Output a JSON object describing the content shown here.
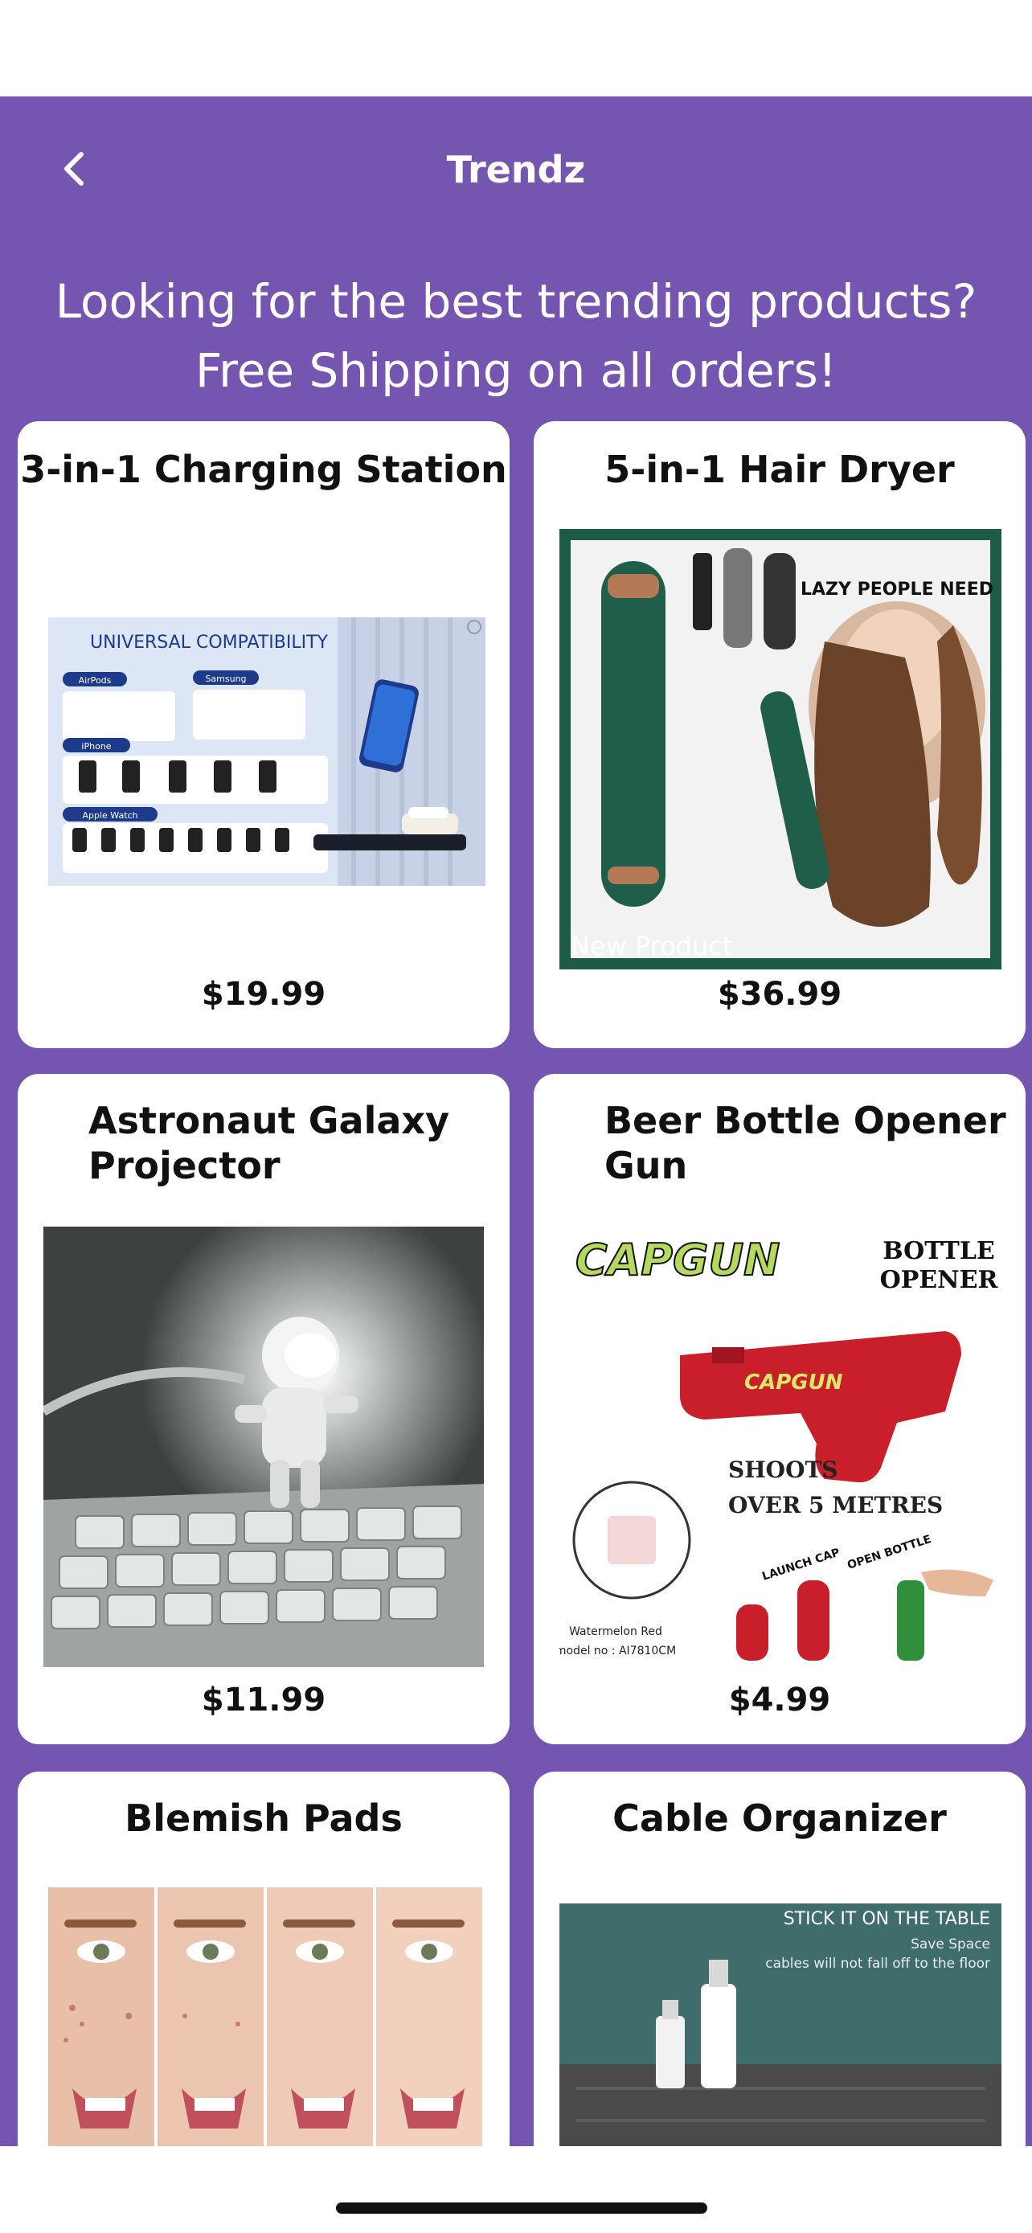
{
  "header": {
    "title": "Trendz",
    "banner_line1": "Looking for the best trending products?",
    "banner_line2": "Free Shipping on all orders!"
  },
  "colors": {
    "background_purple": "#7455b0",
    "card_background": "#ffffff"
  },
  "products": [
    {
      "name": "3-in-1 Charging Station",
      "price": "$19.99",
      "image": {
        "heading": "UNIVERSAL COMPATIBILITY",
        "labels": [
          "AirPods",
          "Samsung",
          "iPhone",
          "Apple Watch"
        ]
      }
    },
    {
      "name": "5-in-1 Hair Dryer",
      "price": "$36.99",
      "image": {
        "tagline": "LAZY PEOPLE NEED",
        "badge": "New Product"
      }
    },
    {
      "name": "Astronaut Galaxy Projector",
      "price": "$11.99",
      "image": {}
    },
    {
      "name": "Beer Bottle Opener Gun",
      "price": "$4.99",
      "image": {
        "brand": "CAPGUN",
        "corner": [
          "BOTTLE",
          "OPENER"
        ],
        "claim": [
          "SHOOTS",
          "OVER 5 METRES"
        ],
        "caption": [
          "Watermelon Red",
          "model no : AI7810CM"
        ],
        "stickers": [
          "LAUNCH CAP",
          "OPEN BOTTLE"
        ]
      }
    },
    {
      "name": "Blemish Pads",
      "price": "",
      "image": {}
    },
    {
      "name": "Cable Organizer",
      "price": "",
      "image": {
        "heading": "STICK IT ON THE TABLE",
        "line1": "Save Space",
        "line2": "cables will not fall off to the floor"
      }
    }
  ]
}
